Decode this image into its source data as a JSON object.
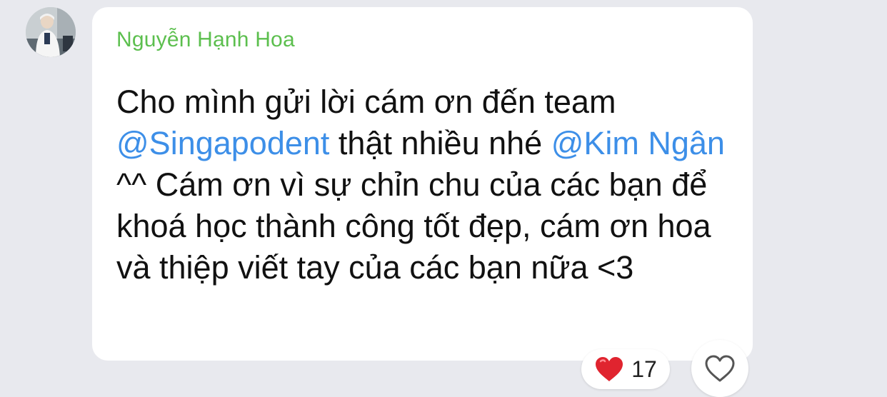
{
  "message": {
    "sender": "Nguyễn Hạnh Hoa",
    "segments": [
      {
        "type": "text",
        "value": "Cho mình gửi lời cám ơn đến team "
      },
      {
        "type": "mention",
        "value": "@Singapodent"
      },
      {
        "type": "text",
        "value": " thật nhiều nhé "
      },
      {
        "type": "mention",
        "value": "@Kim Ngân"
      },
      {
        "type": "text",
        "value": " ^^ Cám ơn vì sự chỉn chu của các bạn để khoá học thành công tốt đẹp, cám ơn hoa và thiệp viết tay của các bạn nữa <3"
      }
    ]
  },
  "reaction": {
    "icon": "red-heart-icon",
    "count": "17",
    "color": "#e0242f"
  },
  "react_button": {
    "icon": "heart-outline-icon"
  },
  "colors": {
    "background": "#e8e9ee",
    "sender": "#5cbf4e",
    "mention": "#3d8fe8",
    "text": "#111111"
  }
}
